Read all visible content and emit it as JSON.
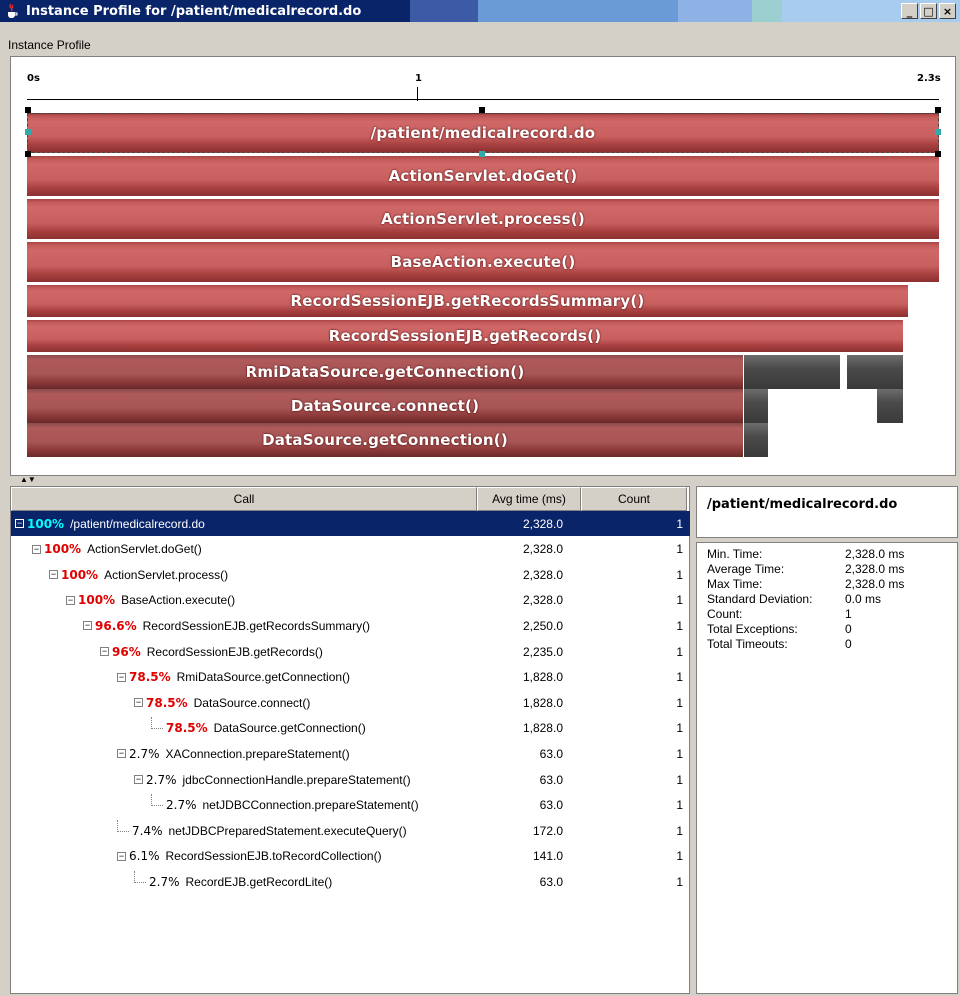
{
  "window": {
    "title": "Instance  Profile for /patient/medicalrecord.do",
    "buttons": {
      "minimize": "_",
      "maximize": "□",
      "close": "×"
    },
    "title_colors": [
      "#0a246a",
      "#3a58a8",
      "#6a8ed0",
      "#5a9ed8",
      "#8eb4e8",
      "#a6caf0"
    ]
  },
  "panel_label": "Instance Profile",
  "timeline": {
    "start_label": "0s",
    "mid_label": "1",
    "end_label": "2.3s",
    "total_ms": 2328
  },
  "bars": [
    {
      "label": "/patient/medicalrecord.do",
      "start_ms": 0,
      "duration_ms": 2328,
      "selected": true
    },
    {
      "label": "ActionServlet.doGet()",
      "start_ms": 0,
      "duration_ms": 2328
    },
    {
      "label": "ActionServlet.process()",
      "start_ms": 0,
      "duration_ms": 2328
    },
    {
      "label": "BaseAction.execute()",
      "start_ms": 0,
      "duration_ms": 2328
    },
    {
      "label": "RecordSessionEJB.getRecordsSummary()",
      "start_ms": 0,
      "duration_ms": 2250
    },
    {
      "label": "RecordSessionEJB.getRecords()",
      "start_ms": 0,
      "duration_ms": 2235
    },
    {
      "label": "RmiDataSource.getConnection()",
      "start_ms": 0,
      "duration_ms": 1828,
      "dark": true
    },
    {
      "label": "DataSource.connect()",
      "start_ms": 0,
      "duration_ms": 1828,
      "dark": true
    },
    {
      "label": "DataSource.getConnection()",
      "start_ms": 0,
      "duration_ms": 1828,
      "dark": true
    }
  ],
  "table": {
    "headers": {
      "call": "Call",
      "avg": "Avg time (ms)",
      "count": "Count"
    },
    "rows": [
      {
        "pct": "100%",
        "name": "/patient/medicalrecord.do",
        "avg": "2,328.0",
        "count": "1",
        "depth": 0,
        "style": "cyan",
        "node": "box",
        "selected": true
      },
      {
        "pct": "100%",
        "name": "ActionServlet.doGet()",
        "avg": "2,328.0",
        "count": "1",
        "depth": 1,
        "style": "hot",
        "node": "box"
      },
      {
        "pct": "100%",
        "name": "ActionServlet.process()",
        "avg": "2,328.0",
        "count": "1",
        "depth": 2,
        "style": "hot",
        "node": "box"
      },
      {
        "pct": "100%",
        "name": "BaseAction.execute()",
        "avg": "2,328.0",
        "count": "1",
        "depth": 3,
        "style": "hot",
        "node": "box"
      },
      {
        "pct": "96.6%",
        "name": "RecordSessionEJB.getRecordsSummary()",
        "avg": "2,250.0",
        "count": "1",
        "depth": 4,
        "style": "hot",
        "node": "box"
      },
      {
        "pct": "96%",
        "name": "RecordSessionEJB.getRecords()",
        "avg": "2,235.0",
        "count": "1",
        "depth": 5,
        "style": "hot",
        "node": "box"
      },
      {
        "pct": "78.5%",
        "name": "RmiDataSource.getConnection()",
        "avg": "1,828.0",
        "count": "1",
        "depth": 6,
        "style": "hot",
        "node": "box"
      },
      {
        "pct": "78.5%",
        "name": "DataSource.connect()",
        "avg": "1,828.0",
        "count": "1",
        "depth": 7,
        "style": "hot",
        "node": "box"
      },
      {
        "pct": "78.5%",
        "name": "DataSource.getConnection()",
        "avg": "1,828.0",
        "count": "1",
        "depth": 8,
        "style": "hot",
        "node": "leaf"
      },
      {
        "pct": "2.7%",
        "name": "XAConnection.prepareStatement()",
        "avg": "63.0",
        "count": "1",
        "depth": 6,
        "style": "norm",
        "node": "box"
      },
      {
        "pct": "2.7%",
        "name": "jdbcConnectionHandle.prepareStatement()",
        "avg": "63.0",
        "count": "1",
        "depth": 7,
        "style": "norm",
        "node": "box"
      },
      {
        "pct": "2.7%",
        "name": "netJDBCConnection.prepareStatement()",
        "avg": "63.0",
        "count": "1",
        "depth": 8,
        "style": "norm",
        "node": "leaf"
      },
      {
        "pct": "7.4%",
        "name": "netJDBCPreparedStatement.executeQuery()",
        "avg": "172.0",
        "count": "1",
        "depth": 6,
        "style": "norm",
        "node": "leaf"
      },
      {
        "pct": "6.1%",
        "name": "RecordSessionEJB.toRecordCollection()",
        "avg": "141.0",
        "count": "1",
        "depth": 6,
        "style": "norm",
        "node": "box"
      },
      {
        "pct": "2.7%",
        "name": "RecordEJB.getRecordLite()",
        "avg": "63.0",
        "count": "1",
        "depth": 7,
        "style": "norm",
        "node": "leaf"
      }
    ]
  },
  "details": {
    "title": "/patient/medicalrecord.do",
    "items": [
      {
        "label": "Min. Time:",
        "value": "2,328.0 ms"
      },
      {
        "label": "Average Time:",
        "value": "2,328.0 ms"
      },
      {
        "label": "Max Time:",
        "value": "2,328.0 ms"
      },
      {
        "label": "Standard Deviation:",
        "value": "0.0 ms"
      },
      {
        "label": "Count:",
        "value": "1"
      },
      {
        "label": "Total Exceptions:",
        "value": "0"
      },
      {
        "label": "Total Timeouts:",
        "value": "0"
      }
    ]
  }
}
